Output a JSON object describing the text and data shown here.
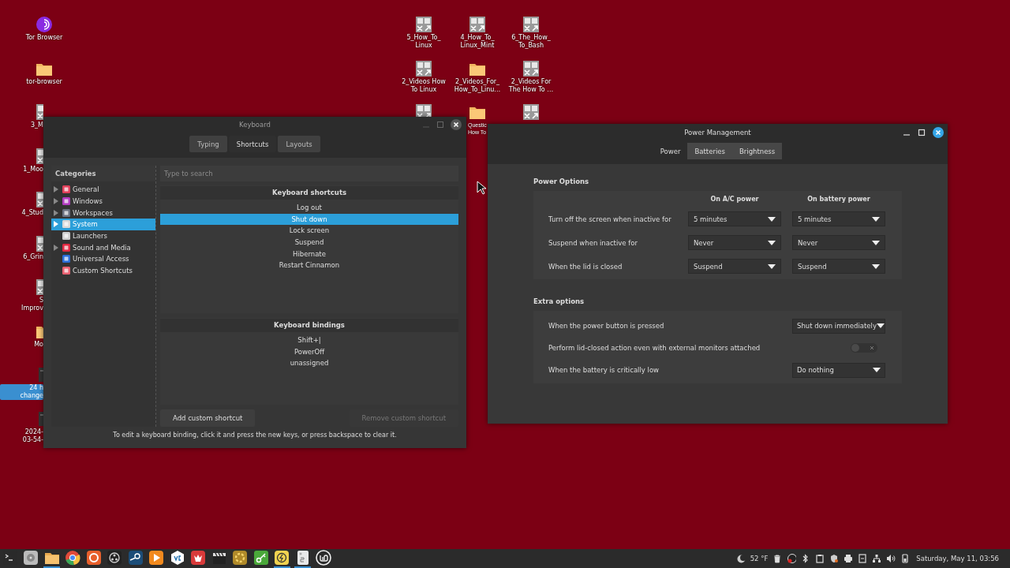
{
  "desktop": {
    "left_column": [
      {
        "kind": "app",
        "label": "Tor Browser",
        "cut": false,
        "selected": false
      },
      {
        "kind": "folder",
        "label": "tor-browser",
        "cut": false,
        "selected": false
      },
      {
        "kind": "document",
        "label": "3_M",
        "cut": true,
        "selected": false
      },
      {
        "kind": "document",
        "label": "1_Moo",
        "cut": true,
        "selected": false
      },
      {
        "kind": "document",
        "label": "4_Stud",
        "cut": true,
        "selected": false
      },
      {
        "kind": "document",
        "label": "6_Grin",
        "cut": true,
        "selected": false
      },
      {
        "kind": "document",
        "label": "S\nImprov",
        "cut": true,
        "selected": false
      },
      {
        "kind": "folder",
        "label": "Mo",
        "cut": true,
        "selected": false
      },
      {
        "kind": "dark",
        "label": "24 h\nchange",
        "cut": true,
        "selected": true
      },
      {
        "kind": "dark",
        "label": "2024-\n03-54-",
        "cut": true,
        "selected": false
      }
    ],
    "group": [
      {
        "kind": "document",
        "label": "5_How_To_\nLinux",
        "cut": false
      },
      {
        "kind": "document",
        "label": "4_How_To_\nLinux_Mint",
        "cut": false
      },
      {
        "kind": "document",
        "label": "6_The_How_\nTo_Bash",
        "cut": false
      },
      {
        "kind": "document",
        "label": "2_Videos How\nTo Linux",
        "cut": false
      },
      {
        "kind": "folder",
        "label": "2_Videos_For_\nHow_To_Linu…",
        "cut": false
      },
      {
        "kind": "document",
        "label": "2_Videos For\nThe How To …",
        "cut": false
      },
      {
        "kind": "document",
        "cut": true
      },
      {
        "kind": "folder",
        "label": "Questic\nHow To",
        "cut": true
      },
      {
        "kind": "document"
      }
    ]
  },
  "keyboard_window": {
    "title": "Keyboard",
    "tabs": [
      {
        "label": "Typing",
        "selected": false
      },
      {
        "label": "Shortcuts",
        "selected": true
      },
      {
        "label": "Layouts",
        "selected": false
      }
    ],
    "categories": {
      "heading": "Categories",
      "items": [
        {
          "label": "General",
          "expandable": true,
          "selected": false,
          "color": "#e0405a"
        },
        {
          "label": "Windows",
          "expandable": true,
          "selected": false,
          "color": "#b03cc0"
        },
        {
          "label": "Workspaces",
          "expandable": true,
          "selected": false,
          "color": "#6a7080"
        },
        {
          "label": "System",
          "expandable": true,
          "selected": true,
          "color": "#d8d8d8"
        },
        {
          "label": "Launchers",
          "expandable": false,
          "selected": false,
          "color": "#cfcfcf"
        },
        {
          "label": "Sound and Media",
          "expandable": true,
          "selected": false,
          "color": "#e02840"
        },
        {
          "label": "Universal Access",
          "expandable": false,
          "selected": false,
          "color": "#2a6ed8"
        },
        {
          "label": "Custom Shortcuts",
          "expandable": false,
          "selected": false,
          "color": "#e86070"
        }
      ]
    },
    "search": {
      "placeholder": "Type to search"
    },
    "shortcuts": {
      "heading": "Keyboard shortcuts",
      "items": [
        {
          "label": "Log out",
          "selected": false
        },
        {
          "label": "Shut down",
          "selected": true
        },
        {
          "label": "Lock screen",
          "selected": false
        },
        {
          "label": "Suspend",
          "selected": false
        },
        {
          "label": "Hibernate",
          "selected": false
        },
        {
          "label": "Restart Cinnamon",
          "selected": false
        }
      ]
    },
    "bindings": {
      "heading": "Keyboard bindings",
      "items": [
        "Shift+|",
        "PowerOff",
        "unassigned"
      ]
    },
    "buttons": [
      {
        "label": "Add custom shortcut",
        "disabled": false
      },
      {
        "label": "Remove custom shortcut",
        "disabled": true
      }
    ],
    "hint": "To edit a keyboard binding, click it and press the new keys, or press backspace to clear it."
  },
  "power_window": {
    "title": "Power Management",
    "tabs": [
      {
        "label": "Power",
        "selected": true
      },
      {
        "label": "Batteries",
        "selected": false
      },
      {
        "label": "Brightness",
        "selected": false
      }
    ],
    "power_options": {
      "heading": "Power Options",
      "columns": [
        "On A/C power",
        "On battery power"
      ],
      "rows": [
        {
          "label": "Turn off the screen when inactive for",
          "values": [
            "5 minutes",
            "5 minutes"
          ]
        },
        {
          "label": "Suspend when inactive for",
          "values": [
            "Never",
            "Never"
          ]
        },
        {
          "label": "When the lid is closed",
          "values": [
            "Suspend",
            "Suspend"
          ]
        }
      ]
    },
    "extra_options": {
      "heading": "Extra options",
      "rows": [
        {
          "kind": "dropdown",
          "label": "When the power button is pressed",
          "value": "Shut down immediately"
        },
        {
          "kind": "switch",
          "label": "Perform lid-closed action even with external monitors attached",
          "on": false
        },
        {
          "kind": "dropdown",
          "label": "When the battery is critically low",
          "value": "Do nothing"
        }
      ]
    }
  },
  "taskbar": {
    "launchers": [
      {
        "kind": "terminal",
        "running": false
      },
      {
        "kind": "disk",
        "running": false
      },
      {
        "kind": "folder",
        "running": true
      },
      {
        "kind": "chrome",
        "running": false
      },
      {
        "kind": "firefox",
        "running": false
      },
      {
        "kind": "obs",
        "running": false
      },
      {
        "kind": "steam",
        "running": false
      },
      {
        "kind": "play",
        "running": false
      },
      {
        "kind": "code",
        "running": false
      },
      {
        "kind": "fox",
        "running": false
      },
      {
        "kind": "clapper",
        "running": false
      },
      {
        "kind": "update",
        "running": false
      },
      {
        "kind": "key",
        "running": false
      },
      {
        "kind": "power",
        "running": true
      },
      {
        "kind": "notes",
        "running": true
      },
      {
        "kind": "mint",
        "running": false
      }
    ],
    "temperature": "52 °F",
    "clock": "Saturday, May 11, 03:56"
  }
}
